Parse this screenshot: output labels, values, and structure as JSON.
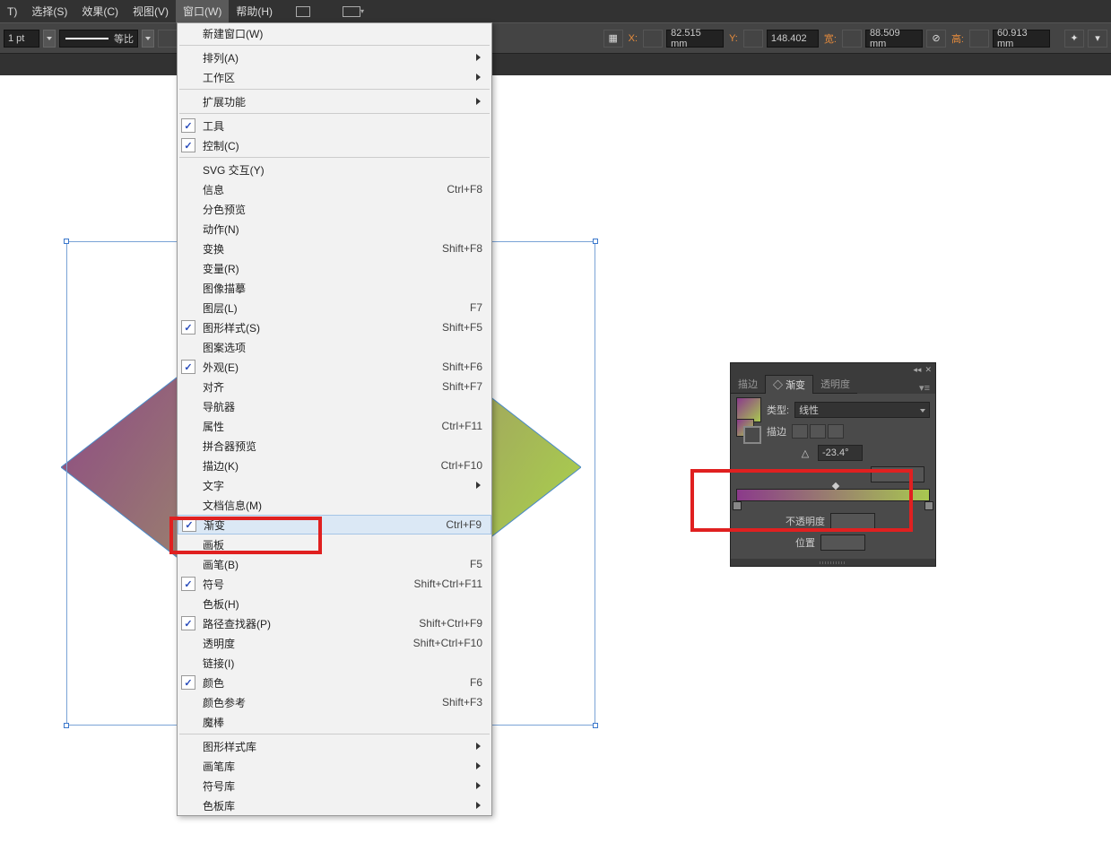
{
  "menubar": {
    "items": [
      "T)",
      "选择(S)",
      "效果(C)",
      "视图(V)",
      "窗口(W)",
      "帮助(H)"
    ],
    "active_index": 4
  },
  "toolbar": {
    "stroke_size": "1 pt",
    "stroke_style": "等比",
    "x_label": "X:",
    "x_value": "82.515 mm",
    "y_label": "Y:",
    "y_value": "148.402",
    "w_label": "宽:",
    "w_value": "88.509 mm",
    "h_label": "高:",
    "h_value": "60.913 mm"
  },
  "window_menu": {
    "groups": [
      [
        {
          "label": "新建窗口(W)"
        }
      ],
      [
        {
          "label": "排列(A)",
          "submenu": true
        },
        {
          "label": "工作区",
          "submenu": true
        }
      ],
      [
        {
          "label": "扩展功能",
          "submenu": true
        }
      ],
      [
        {
          "label": "工具",
          "checked": true
        },
        {
          "label": "控制(C)",
          "checked": true
        }
      ],
      [
        {
          "label": "SVG 交互(Y)"
        },
        {
          "label": "信息",
          "shortcut": "Ctrl+F8"
        },
        {
          "label": "分色预览"
        },
        {
          "label": "动作(N)"
        },
        {
          "label": "变换",
          "shortcut": "Shift+F8"
        },
        {
          "label": "变量(R)"
        },
        {
          "label": "图像描摹"
        },
        {
          "label": "图层(L)",
          "shortcut": "F7"
        },
        {
          "label": "图形样式(S)",
          "shortcut": "Shift+F5",
          "checked": true
        },
        {
          "label": "图案选项"
        },
        {
          "label": "外观(E)",
          "shortcut": "Shift+F6",
          "checked": true
        },
        {
          "label": "对齐",
          "shortcut": "Shift+F7"
        },
        {
          "label": "导航器"
        },
        {
          "label": "属性",
          "shortcut": "Ctrl+F11"
        },
        {
          "label": "拼合器预览"
        },
        {
          "label": "描边(K)",
          "shortcut": "Ctrl+F10"
        },
        {
          "label": "文字",
          "submenu": true
        },
        {
          "label": "文档信息(M)"
        },
        {
          "label": "渐变",
          "shortcut": "Ctrl+F9",
          "checked": true,
          "highlighted": true
        },
        {
          "label": "画板"
        },
        {
          "label": "画笔(B)",
          "shortcut": "F5"
        },
        {
          "label": "符号",
          "shortcut": "Shift+Ctrl+F11",
          "checked": true
        },
        {
          "label": "色板(H)"
        },
        {
          "label": "路径查找器(P)",
          "shortcut": "Shift+Ctrl+F9",
          "checked": true
        },
        {
          "label": "透明度",
          "shortcut": "Shift+Ctrl+F10"
        },
        {
          "label": "链接(I)"
        },
        {
          "label": "颜色",
          "shortcut": "F6",
          "checked": true
        },
        {
          "label": "颜色参考",
          "shortcut": "Shift+F3"
        },
        {
          "label": "魔棒"
        }
      ],
      [
        {
          "label": "图形样式库",
          "submenu": true
        },
        {
          "label": "画笔库",
          "submenu": true
        },
        {
          "label": "符号库",
          "submenu": true
        },
        {
          "label": "色板库",
          "submenu": true
        }
      ]
    ]
  },
  "gradient_panel": {
    "tabs": [
      "描边",
      "渐变",
      "透明度"
    ],
    "active_tab": 1,
    "type_label": "类型:",
    "type_value": "线性",
    "stroke_label": "描边",
    "angle_value": "-23.4°",
    "opacity_label": "不透明度",
    "location_label": "位置"
  }
}
